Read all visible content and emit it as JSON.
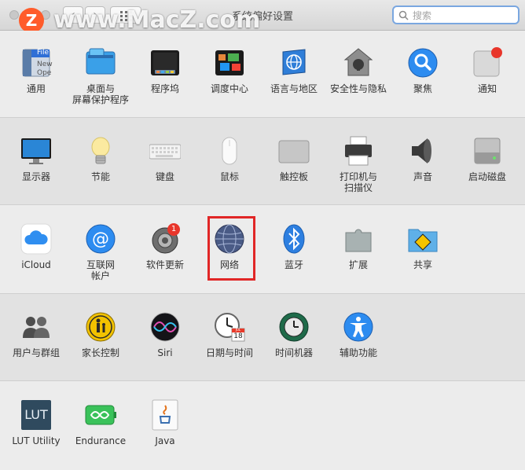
{
  "window": {
    "title": "系统偏好设置",
    "search": {
      "placeholder": "搜索",
      "value": ""
    },
    "nav": {
      "back": "‹",
      "forward": "›"
    }
  },
  "watermark": {
    "logo": "Z",
    "text": "www.MacZ.com"
  },
  "sections": [
    [
      {
        "label": "通用",
        "icon": "general-icon",
        "file_text": [
          "File",
          "New",
          "Ope"
        ]
      },
      {
        "label": "桌面与\n屏幕保护程序",
        "icon": "desktop-screensaver-icon"
      },
      {
        "label": "程序坞",
        "icon": "dock-icon"
      },
      {
        "label": "调度中心",
        "icon": "mission-control-icon"
      },
      {
        "label": "语言与地区",
        "icon": "language-region-icon"
      },
      {
        "label": "安全性与隐私",
        "icon": "security-privacy-icon"
      },
      {
        "label": "聚焦",
        "icon": "spotlight-icon"
      },
      {
        "label": "通知",
        "icon": "notifications-icon"
      }
    ],
    [
      {
        "label": "显示器",
        "icon": "displays-icon"
      },
      {
        "label": "节能",
        "icon": "energy-saver-icon"
      },
      {
        "label": "键盘",
        "icon": "keyboard-icon"
      },
      {
        "label": "鼠标",
        "icon": "mouse-icon"
      },
      {
        "label": "触控板",
        "icon": "trackpad-icon"
      },
      {
        "label": "打印机与\n扫描仪",
        "icon": "printers-scanners-icon"
      },
      {
        "label": "声音",
        "icon": "sound-icon"
      },
      {
        "label": "启动磁盘",
        "icon": "startup-disk-icon"
      }
    ],
    [
      {
        "label": "iCloud",
        "icon": "icloud-icon"
      },
      {
        "label": "互联网\n帐户",
        "icon": "internet-accounts-icon"
      },
      {
        "label": "软件更新",
        "icon": "software-update-icon",
        "badge": "1"
      },
      {
        "label": "网络",
        "icon": "network-icon",
        "highlighted": true
      },
      {
        "label": "蓝牙",
        "icon": "bluetooth-icon"
      },
      {
        "label": "扩展",
        "icon": "extensions-icon"
      },
      {
        "label": "共享",
        "icon": "sharing-icon"
      }
    ],
    [
      {
        "label": "用户与群组",
        "icon": "users-groups-icon"
      },
      {
        "label": "家长控制",
        "icon": "parental-controls-icon"
      },
      {
        "label": "Siri",
        "icon": "siri-icon"
      },
      {
        "label": "日期与时间",
        "icon": "date-time-icon",
        "date_text": "JUL",
        "day_text": "18"
      },
      {
        "label": "时间机器",
        "icon": "time-machine-icon"
      },
      {
        "label": "辅助功能",
        "icon": "accessibility-icon"
      }
    ],
    [
      {
        "label": "LUT Utility",
        "icon": "lut-utility-icon",
        "icon_text": "LUT"
      },
      {
        "label": "Endurance",
        "icon": "endurance-icon"
      },
      {
        "label": "Java",
        "icon": "java-icon"
      }
    ]
  ],
  "colors": {
    "highlight": "#e12626",
    "search_focus": "#7aa7e0",
    "watermark_logo": "#ff5c2b"
  }
}
